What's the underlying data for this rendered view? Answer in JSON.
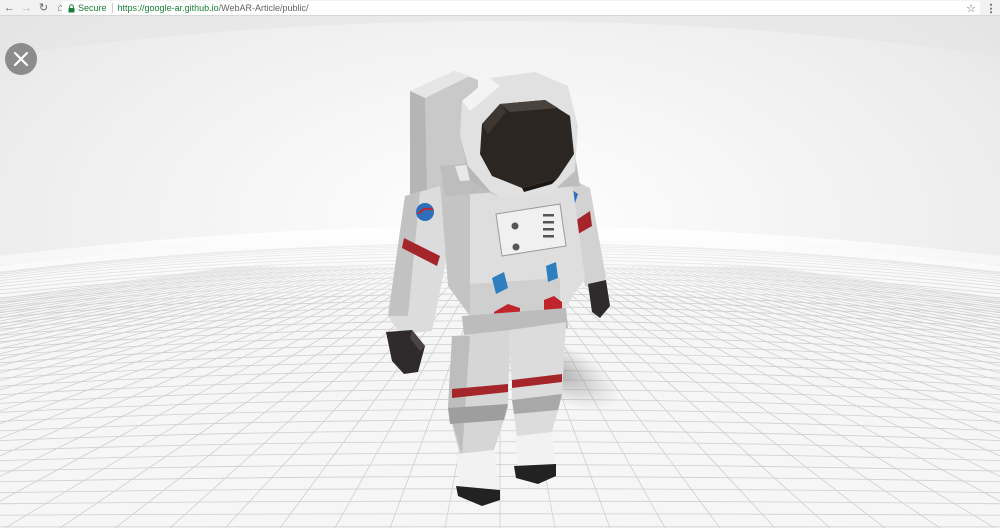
{
  "browser": {
    "secure_label": "Secure",
    "url_host": "https://google-ar.github.io",
    "url_path": "/WebAR-Article/public/",
    "icons": {
      "back": "back-arrow-icon",
      "forward": "forward-arrow-icon",
      "reload": "reload-icon",
      "home": "home-icon",
      "lock": "lock-icon",
      "bookmark": "star-icon",
      "menu": "kebab-menu-icon"
    }
  },
  "viewer": {
    "close_icon": "close-icon",
    "model": "astronaut",
    "colors": {
      "suit": "#d9d9d9",
      "visor": "#2b2622",
      "accent_red": "#c0252b",
      "accent_blue": "#2d7fc0",
      "gloves": "#2f2a2b",
      "floor": "#f5f5f5",
      "grid": "#cfcfcf"
    }
  }
}
